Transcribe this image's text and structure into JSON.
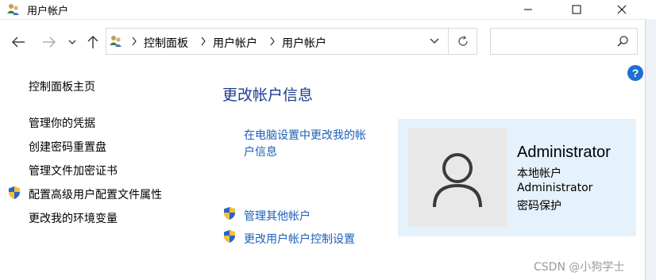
{
  "window": {
    "title": "用户帐户",
    "controls": [
      "minimize-icon",
      "maximize-icon",
      "close-icon"
    ]
  },
  "navbar": {
    "breadcrumb": [
      "控制面板",
      "用户帐户",
      "用户帐户"
    ],
    "search_placeholder": "",
    "icons": [
      "back-arrow-icon",
      "forward-arrow-icon",
      "recent-dropdown-icon",
      "up-arrow-icon",
      "users-icon",
      "chevron-down-icon",
      "refresh-icon",
      "search-icon"
    ]
  },
  "sidebar": {
    "items": [
      {
        "label": "控制面板主页",
        "shield": false
      },
      {
        "label": "管理你的凭据",
        "shield": false
      },
      {
        "label": "创建密码重置盘",
        "shield": false
      },
      {
        "label": "管理文件加密证书",
        "shield": false
      },
      {
        "label": "配置高级用户配置文件属性",
        "shield": true
      },
      {
        "label": "更改我的环境变量",
        "shield": false
      }
    ]
  },
  "main": {
    "title": "更改帐户信息",
    "settings_link_line1": "在电脑设置中更改我的帐",
    "settings_link_line2": "户信息",
    "links": [
      {
        "label": "管理其他帐户",
        "shield": true
      },
      {
        "label": "更改用户帐户控制设置",
        "shield": true
      }
    ]
  },
  "account": {
    "name": "Administrator",
    "type": "本地帐户",
    "group": "Administrator",
    "password_status": "密码保护"
  },
  "help": "?",
  "watermark": "CSDN @小狗学士",
  "colors": {
    "link": "#1c5fb8",
    "heading": "#1e3b8f",
    "card_bg": "#e5f1fb"
  }
}
